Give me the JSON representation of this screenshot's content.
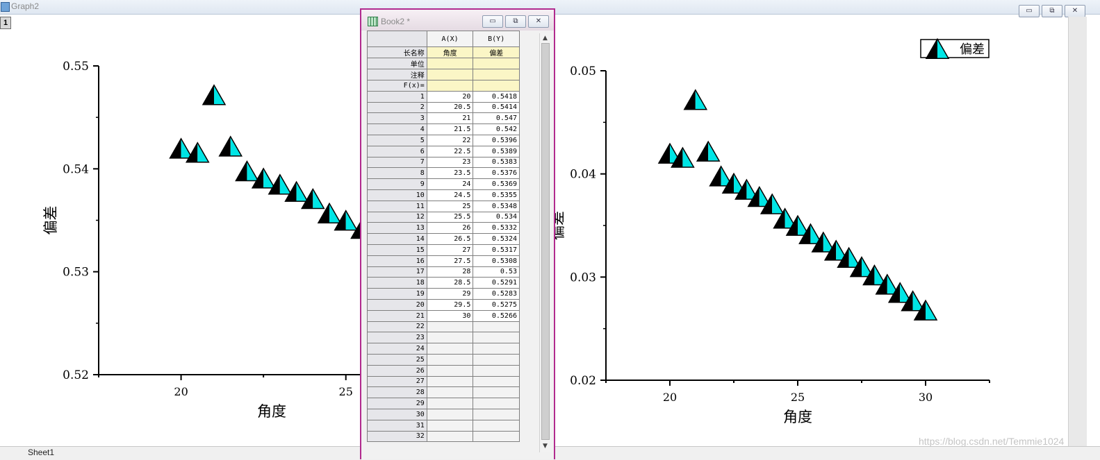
{
  "graph_window": {
    "title": "Graph2",
    "layer_label": "1",
    "bottom_tab": "Sheet1",
    "controls": [
      "▭",
      "⧉",
      "✕"
    ]
  },
  "book_window": {
    "title": "Book2 *",
    "controls": [
      "▭",
      "⧉",
      "✕"
    ],
    "columns": [
      {
        "header": "A(X)",
        "long_name": "角度",
        "units": "",
        "comments": "",
        "fx": ""
      },
      {
        "header": "B(Y)",
        "long_name": "偏差",
        "units": "",
        "comments": "",
        "fx": ""
      }
    ],
    "row_labels": [
      "长名称",
      "单位",
      "注释",
      "F(x)="
    ],
    "rows": [
      [
        "1",
        "20",
        "0.5418"
      ],
      [
        "2",
        "20.5",
        "0.5414"
      ],
      [
        "3",
        "21",
        "0.547"
      ],
      [
        "4",
        "21.5",
        "0.542"
      ],
      [
        "5",
        "22",
        "0.5396"
      ],
      [
        "6",
        "22.5",
        "0.5389"
      ],
      [
        "7",
        "23",
        "0.5383"
      ],
      [
        "8",
        "23.5",
        "0.5376"
      ],
      [
        "9",
        "24",
        "0.5369"
      ],
      [
        "10",
        "24.5",
        "0.5355"
      ],
      [
        "11",
        "25",
        "0.5348"
      ],
      [
        "12",
        "25.5",
        "0.534"
      ],
      [
        "13",
        "26",
        "0.5332"
      ],
      [
        "14",
        "26.5",
        "0.5324"
      ],
      [
        "15",
        "27",
        "0.5317"
      ],
      [
        "16",
        "27.5",
        "0.5308"
      ],
      [
        "17",
        "28",
        "0.53"
      ],
      [
        "18",
        "28.5",
        "0.5291"
      ],
      [
        "19",
        "29",
        "0.5283"
      ],
      [
        "20",
        "29.5",
        "0.5275"
      ],
      [
        "21",
        "30",
        "0.5266"
      ]
    ],
    "empty_rows": [
      "22",
      "23",
      "24",
      "25",
      "26",
      "27",
      "28",
      "29",
      "30",
      "31",
      "32"
    ]
  },
  "watermark": "https://blog.csdn.net/Temmie1024",
  "colors": {
    "marker_fill": "#00e5e5",
    "marker_dark": "#000000",
    "frame_border": "#b12a8e"
  },
  "chart_data": [
    {
      "type": "scatter",
      "title": "",
      "xlabel": "角度",
      "ylabel": "偏差",
      "xlim": [
        17.5,
        28
      ],
      "ylim": [
        0.52,
        0.55
      ],
      "xticks": [
        "20",
        "25"
      ],
      "yticks": [
        "0.52",
        "0.53",
        "0.54",
        "0.55"
      ],
      "x": [
        20,
        20.5,
        21,
        21.5,
        22,
        22.5,
        23,
        23.5,
        24,
        24.5,
        25,
        25.5,
        26,
        26.5,
        27,
        27.5,
        28
      ],
      "y": [
        0.5418,
        0.5414,
        0.547,
        0.542,
        0.5396,
        0.5389,
        0.5383,
        0.5376,
        0.5369,
        0.5355,
        0.5348,
        0.534,
        0.5332,
        0.5324,
        0.5317,
        0.5308,
        0.53
      ],
      "marker": "half-filled-triangle"
    },
    {
      "type": "scatter",
      "title": "",
      "xlabel": "角度",
      "ylabel": "偏差",
      "xlim": [
        17.5,
        32.5
      ],
      "ylim": [
        0.02,
        0.05
      ],
      "xticks": [
        "20",
        "25",
        "30"
      ],
      "yticks": [
        "0.02",
        "0.03",
        "0.04",
        "0.05"
      ],
      "legend": {
        "position": "top-right",
        "entries": [
          "偏差"
        ]
      },
      "x": [
        20,
        20.5,
        21,
        21.5,
        22,
        22.5,
        23,
        23.5,
        24,
        24.5,
        25,
        25.5,
        26,
        26.5,
        27,
        27.5,
        28,
        28.5,
        29,
        29.5,
        30
      ],
      "y": [
        0.0418,
        0.0414,
        0.047,
        0.042,
        0.0396,
        0.0389,
        0.0383,
        0.0376,
        0.0369,
        0.0355,
        0.0348,
        0.034,
        0.0332,
        0.0324,
        0.0317,
        0.0308,
        0.03,
        0.0291,
        0.0283,
        0.0275,
        0.0266
      ],
      "marker": "half-filled-triangle"
    }
  ]
}
